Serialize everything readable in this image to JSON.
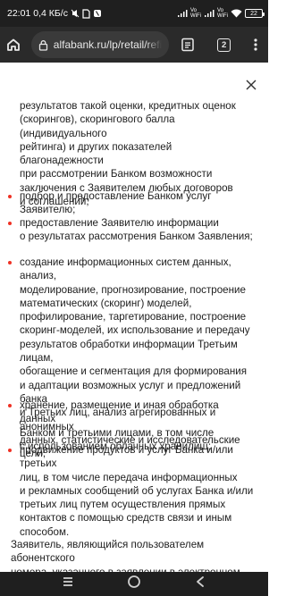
{
  "status_bar": {
    "time": "22:01",
    "speed": "0,4 КБ/с",
    "volte1": "Vo\nWiFi",
    "volte2": "Vo\nWiFi",
    "battery": "22"
  },
  "browser": {
    "url": "alfabank.ru/lp/retail/refi",
    "tab_count": "2"
  },
  "content": {
    "items": [
      "результатов такой оценки, кредитных оценок\n(скорингов), скорингового балла (индивидуального\nрейтинга) и других показателей благонадежности\nпри рассмотрении Банком возможности\nзаключения с Заявителем любых договоров\nи соглашений;",
      "подбор и предоставление Банком услуг Заявителю;",
      "предоставление Заявителю информации\nо результатах рассмотрения Банком Заявления;",
      "создание информационных систем данных, анализ,\nмоделирование, прогнозирование, построение\nматематических (скоринг) моделей,\nпрофилирование, таргетирование, построение\nскоринг-моделей, их использование и передачу\nрезультатов обработки информации Третьим лицам,\nобогащение и сегментация для формирования\nи адаптации возможных услуг и предложений банка\nи Третьих лиц, анализ агрегированных и анонимных\nданных, статистические и исследовательские цели;",
      "хранение, размещение и иная обработка данных\nБанком и третьими лицами, в том числе\nс использованием облачных хранилищ;",
      "продвижение продуктов и услуг Банка и/или третьих\nлиц, в том числе передача информационных\nи рекламных сообщений об услугах Банка и/или\nтретьих лиц путем осуществления прямых\nконтактов с помощью средств связи и иным\nспособом."
    ],
    "paragraph": "Заявитель, являющийся пользователем абонентского\nномера, указанного в заявлении в электронном виде"
  },
  "colors": {
    "bullet": "#ef3124",
    "status_bg": "#1f1f1f",
    "browser_bg": "#2a2a2a"
  },
  "icons": {
    "home": "home-icon",
    "lock": "lock-icon",
    "reader": "reader-mode-icon",
    "menu": "more-vertical-icon",
    "close": "close-icon",
    "nav_back": "back-icon",
    "nav_home": "nav-home-icon",
    "nav_recents": "recents-icon"
  }
}
